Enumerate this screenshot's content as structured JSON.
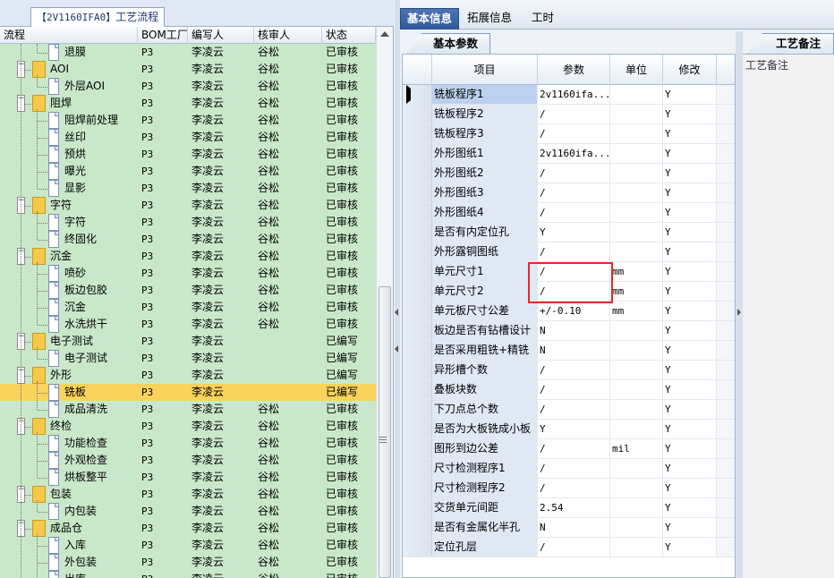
{
  "left_panel": {
    "tab_id": "【2V1160IFA0】",
    "tab_title": "工艺流程",
    "columns": [
      "流程",
      "BOM工厂",
      "编写人",
      "核审人",
      "状态"
    ],
    "rows": [
      {
        "name": "退膜",
        "level": 2,
        "type": "doc",
        "factory": "P3",
        "writer": "李凌云",
        "reviewer": "谷松",
        "status": "已审核"
      },
      {
        "name": "AOI",
        "level": 1,
        "type": "folder",
        "factory": "P3",
        "writer": "李凌云",
        "reviewer": "谷松",
        "status": "已审核"
      },
      {
        "name": "外层AOI",
        "level": 2,
        "type": "doc",
        "factory": "P3",
        "writer": "李凌云",
        "reviewer": "谷松",
        "status": "已审核"
      },
      {
        "name": "阻焊",
        "level": 1,
        "type": "folder",
        "factory": "P3",
        "writer": "李凌云",
        "reviewer": "谷松",
        "status": "已审核"
      },
      {
        "name": "阻焊前处理",
        "level": 2,
        "type": "doc",
        "factory": "P3",
        "writer": "李凌云",
        "reviewer": "谷松",
        "status": "已审核"
      },
      {
        "name": "丝印",
        "level": 2,
        "type": "doc",
        "factory": "P3",
        "writer": "李凌云",
        "reviewer": "谷松",
        "status": "已审核"
      },
      {
        "name": "预烘",
        "level": 2,
        "type": "doc",
        "factory": "P3",
        "writer": "李凌云",
        "reviewer": "谷松",
        "status": "已审核"
      },
      {
        "name": "曝光",
        "level": 2,
        "type": "doc",
        "factory": "P3",
        "writer": "李凌云",
        "reviewer": "谷松",
        "status": "已审核"
      },
      {
        "name": "显影",
        "level": 2,
        "type": "doc",
        "factory": "P3",
        "writer": "李凌云",
        "reviewer": "谷松",
        "status": "已审核"
      },
      {
        "name": "字符",
        "level": 1,
        "type": "folder",
        "factory": "P3",
        "writer": "李凌云",
        "reviewer": "谷松",
        "status": "已审核"
      },
      {
        "name": "字符",
        "level": 2,
        "type": "doc",
        "factory": "P3",
        "writer": "李凌云",
        "reviewer": "谷松",
        "status": "已审核"
      },
      {
        "name": "终固化",
        "level": 2,
        "type": "doc",
        "factory": "P3",
        "writer": "李凌云",
        "reviewer": "谷松",
        "status": "已审核"
      },
      {
        "name": "沉金",
        "level": 1,
        "type": "folder",
        "factory": "P3",
        "writer": "李凌云",
        "reviewer": "谷松",
        "status": "已审核"
      },
      {
        "name": "喷砂",
        "level": 2,
        "type": "doc",
        "factory": "P3",
        "writer": "李凌云",
        "reviewer": "谷松",
        "status": "已审核"
      },
      {
        "name": "板边包胶",
        "level": 2,
        "type": "doc",
        "factory": "P3",
        "writer": "李凌云",
        "reviewer": "谷松",
        "status": "已审核"
      },
      {
        "name": "沉金",
        "level": 2,
        "type": "doc",
        "factory": "P3",
        "writer": "李凌云",
        "reviewer": "谷松",
        "status": "已审核"
      },
      {
        "name": "水洗烘干",
        "level": 2,
        "type": "doc",
        "factory": "P3",
        "writer": "李凌云",
        "reviewer": "谷松",
        "status": "已审核"
      },
      {
        "name": "电子测试",
        "level": 1,
        "type": "folder",
        "factory": "P3",
        "writer": "李凌云",
        "reviewer": "",
        "status": "已编写"
      },
      {
        "name": "电子测试",
        "level": 2,
        "type": "doc",
        "factory": "P3",
        "writer": "李凌云",
        "reviewer": "",
        "status": "已编写"
      },
      {
        "name": "外形",
        "level": 1,
        "type": "folder",
        "factory": "P3",
        "writer": "李凌云",
        "reviewer": "",
        "status": "已编写"
      },
      {
        "name": "铣板",
        "level": 2,
        "type": "doc",
        "factory": "P3",
        "writer": "李凌云",
        "reviewer": "",
        "status": "已编写",
        "selected": true
      },
      {
        "name": "成品清洗",
        "level": 2,
        "type": "doc",
        "factory": "P3",
        "writer": "李凌云",
        "reviewer": "谷松",
        "status": "已审核"
      },
      {
        "name": "终检",
        "level": 1,
        "type": "folder",
        "factory": "P3",
        "writer": "李凌云",
        "reviewer": "谷松",
        "status": "已审核"
      },
      {
        "name": "功能检查",
        "level": 2,
        "type": "doc",
        "factory": "P3",
        "writer": "李凌云",
        "reviewer": "谷松",
        "status": "已审核"
      },
      {
        "name": "外观检查",
        "level": 2,
        "type": "doc",
        "factory": "P3",
        "writer": "李凌云",
        "reviewer": "谷松",
        "status": "已审核"
      },
      {
        "name": "烘板整平",
        "level": 2,
        "type": "doc",
        "factory": "P3",
        "writer": "李凌云",
        "reviewer": "谷松",
        "status": "已审核"
      },
      {
        "name": "包装",
        "level": 1,
        "type": "folder",
        "factory": "P3",
        "writer": "李凌云",
        "reviewer": "谷松",
        "status": "已审核"
      },
      {
        "name": "内包装",
        "level": 2,
        "type": "doc",
        "factory": "P3",
        "writer": "李凌云",
        "reviewer": "谷松",
        "status": "已审核"
      },
      {
        "name": "成品仓",
        "level": 1,
        "type": "folder",
        "factory": "P3",
        "writer": "李凌云",
        "reviewer": "谷松",
        "status": "已审核"
      },
      {
        "name": "入库",
        "level": 2,
        "type": "doc",
        "factory": "P3",
        "writer": "李凌云",
        "reviewer": "谷松",
        "status": "已审核"
      },
      {
        "name": "外包装",
        "level": 2,
        "type": "doc",
        "factory": "P3",
        "writer": "李凌云",
        "reviewer": "谷松",
        "status": "已审核"
      },
      {
        "name": "出库",
        "level": 2,
        "type": "doc",
        "factory": "P3",
        "writer": "李凌云",
        "reviewer": "谷松",
        "status": "已审核"
      }
    ]
  },
  "top_tabs": [
    "基本信息",
    "拓展信息",
    "工时"
  ],
  "sub_tab": "基本参数",
  "grid": {
    "columns": [
      "项目",
      "参数",
      "单位",
      "修改"
    ],
    "rows": [
      {
        "item": "铣板程序1",
        "param": "2v1160ifa...",
        "unit": "",
        "mod": "Y",
        "current": true
      },
      {
        "item": "铣板程序2",
        "param": "/",
        "unit": "",
        "mod": "Y"
      },
      {
        "item": "铣板程序3",
        "param": "/",
        "unit": "",
        "mod": "Y"
      },
      {
        "item": "外形图纸1",
        "param": "2v1160ifa...",
        "unit": "",
        "mod": "Y"
      },
      {
        "item": "外形图纸2",
        "param": "/",
        "unit": "",
        "mod": "Y"
      },
      {
        "item": "外形图纸3",
        "param": "/",
        "unit": "",
        "mod": "Y"
      },
      {
        "item": "外形图纸4",
        "param": "/",
        "unit": "",
        "mod": "Y"
      },
      {
        "item": "是否有内定位孔",
        "param": "Y",
        "unit": "",
        "mod": "Y"
      },
      {
        "item": "外形露铜图纸",
        "param": "/",
        "unit": "",
        "mod": "Y"
      },
      {
        "item": "单元尺寸1",
        "param": "/",
        "unit": "mm",
        "mod": "Y"
      },
      {
        "item": "单元尺寸2",
        "param": "/",
        "unit": "mm",
        "mod": "Y"
      },
      {
        "item": "单元板尺寸公差",
        "param": "+/-0.10",
        "unit": "mm",
        "mod": "Y"
      },
      {
        "item": "板边是否有钻槽设计",
        "param": "N",
        "unit": "",
        "mod": "Y"
      },
      {
        "item": "是否采用粗铣+精铣",
        "param": "N",
        "unit": "",
        "mod": "Y"
      },
      {
        "item": "异形槽个数",
        "param": "/",
        "unit": "",
        "mod": "Y"
      },
      {
        "item": "叠板块数",
        "param": "/",
        "unit": "",
        "mod": "Y"
      },
      {
        "item": "下刀点总个数",
        "param": "/",
        "unit": "",
        "mod": "Y"
      },
      {
        "item": "是否为大板铣成小板",
        "param": "Y",
        "unit": "",
        "mod": "Y"
      },
      {
        "item": "图形到边公差",
        "param": "/",
        "unit": "mil",
        "mod": "Y"
      },
      {
        "item": "尺寸检测程序1",
        "param": "/",
        "unit": "",
        "mod": "Y"
      },
      {
        "item": "尺寸检测程序2",
        "param": "/",
        "unit": "",
        "mod": "Y"
      },
      {
        "item": "交货单元间距",
        "param": "2.54",
        "unit": "",
        "mod": "Y"
      },
      {
        "item": "是否有金属化半孔",
        "param": "N",
        "unit": "",
        "mod": "Y"
      },
      {
        "item": "定位孔层",
        "param": "/",
        "unit": "",
        "mod": "Y"
      }
    ]
  },
  "note_panel": {
    "tab": "工艺备注",
    "label": "工艺备注"
  },
  "colors": {
    "tree_bg": "#c9e8c9",
    "selected_row": "#f9d35c",
    "active_tab": "#2f5897",
    "highlight_box": "#e8262a"
  }
}
